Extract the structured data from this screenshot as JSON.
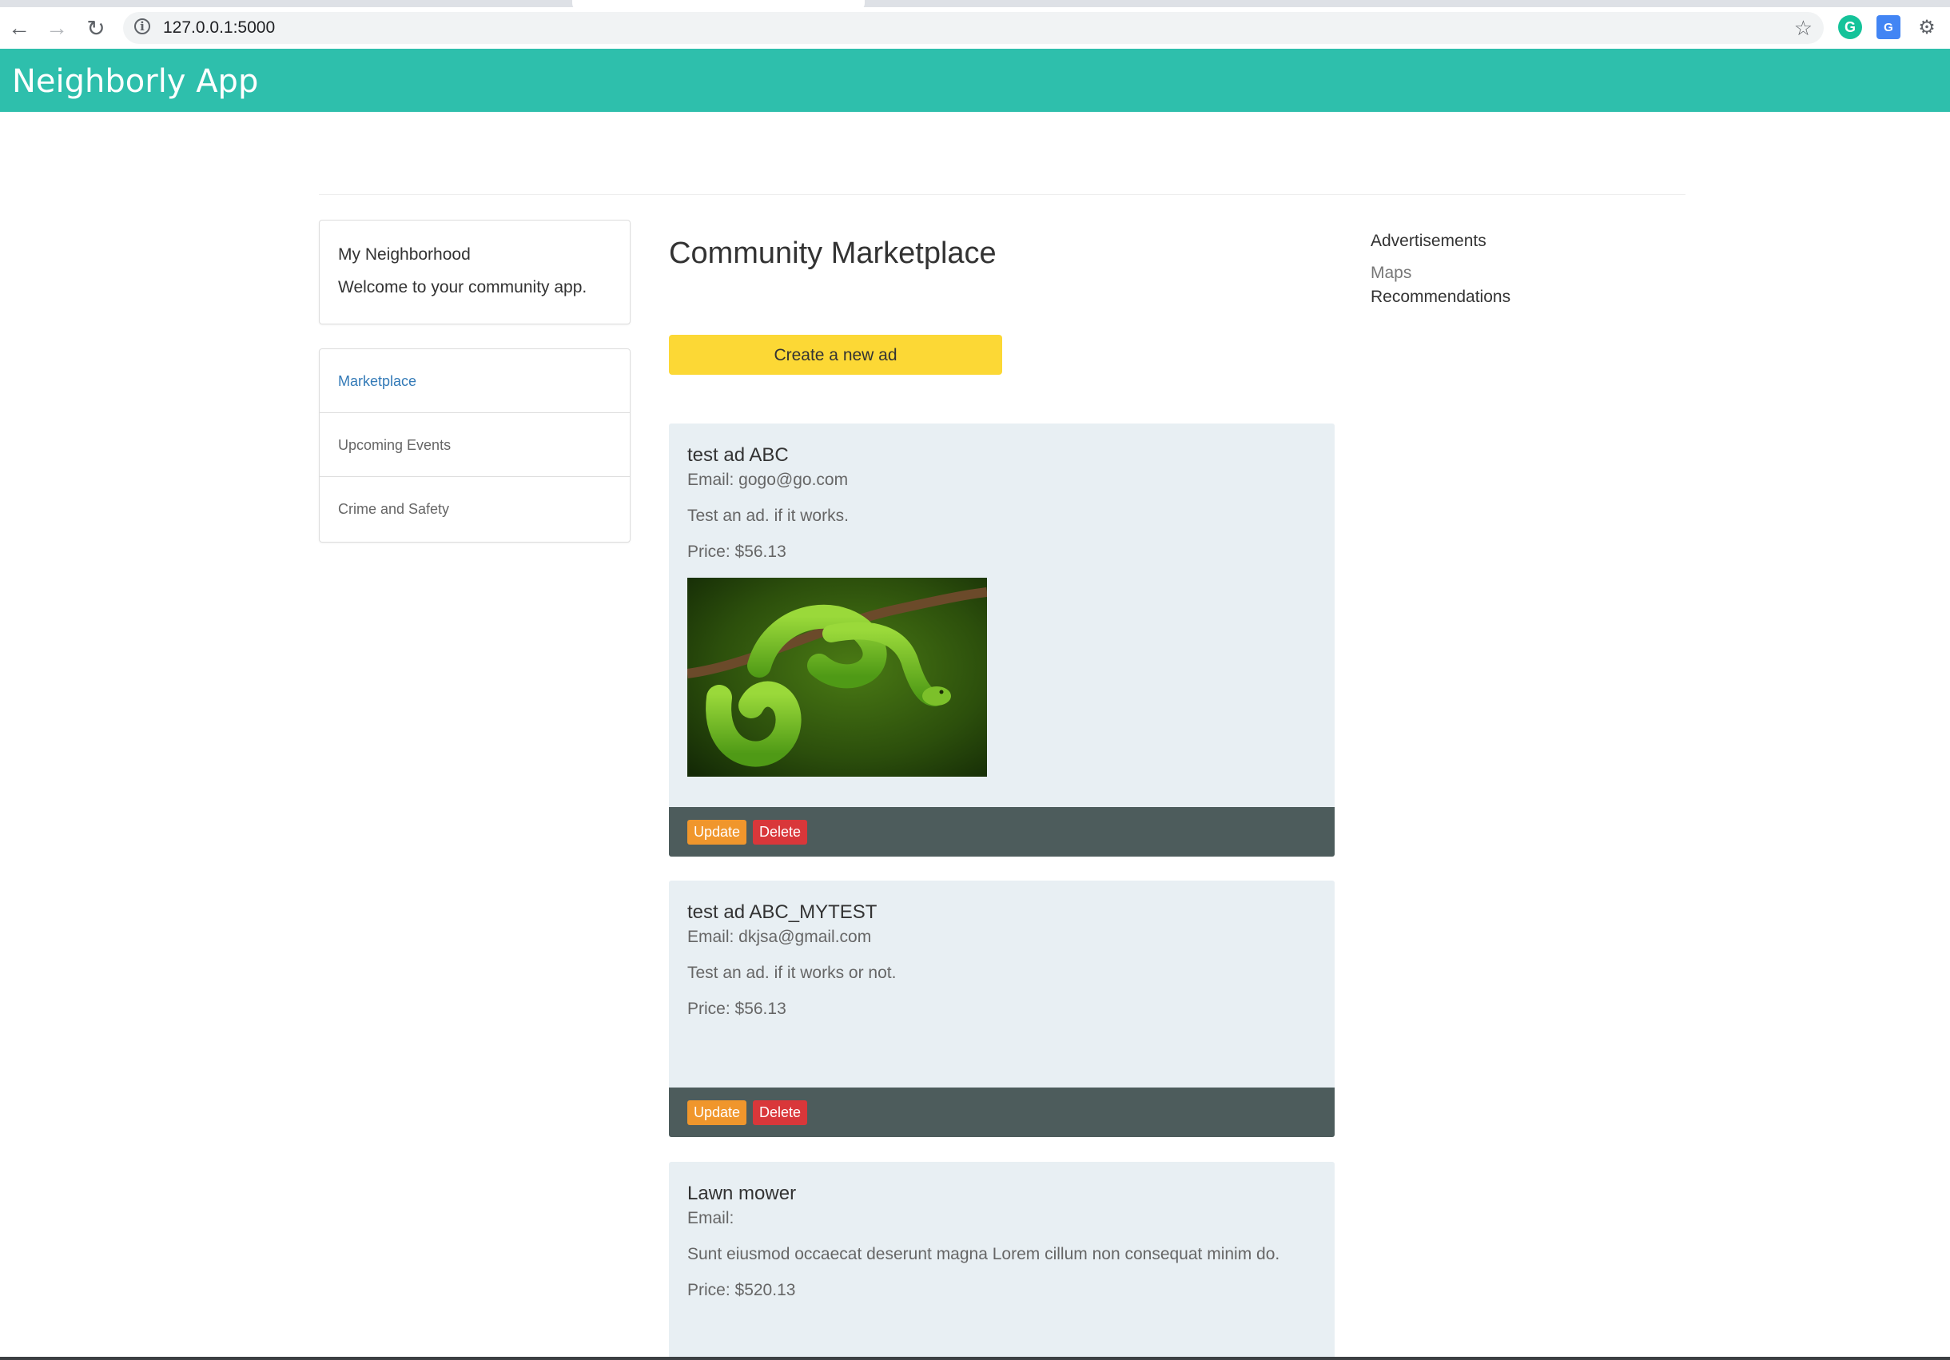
{
  "browser": {
    "url": "127.0.0.1:5000",
    "icons": {
      "back": "back-arrow-icon",
      "forward": "forward-arrow-icon",
      "reload": "reload-icon",
      "info": "info-icon",
      "bookmark": "star-icon",
      "extensions": [
        "grammarly-icon",
        "translate-icon",
        "puzzle-icon"
      ]
    }
  },
  "app": {
    "title": "Neighborly App",
    "brand_color": "#2ebfac"
  },
  "sidebar": {
    "intro": {
      "title": "My Neighborhood",
      "text": "Welcome to your community app."
    },
    "nav": [
      {
        "label": "Marketplace",
        "active": true
      },
      {
        "label": "Upcoming Events",
        "active": false
      },
      {
        "label": "Crime and Safety",
        "active": false
      }
    ]
  },
  "main": {
    "title": "Community Marketplace",
    "create_label": "Create a new ad",
    "ads": [
      {
        "title": "test ad ABC",
        "email": "Email: gogo@go.com",
        "description": "Test an ad. if it works.",
        "price": "Price: $56.13",
        "has_image": true,
        "update_label": "Update",
        "delete_label": "Delete"
      },
      {
        "title": "test ad ABC_MYTEST",
        "email": "Email: dkjsa@gmail.com",
        "description": "Test an ad. if it works or not.",
        "price": "Price: $56.13",
        "has_image": false,
        "update_label": "Update",
        "delete_label": "Delete"
      },
      {
        "title": "Lawn mower",
        "email": "Email:",
        "description": "Sunt eiusmod occaecat deserunt magna Lorem cillum non consequat minim do.",
        "price": "Price: $520.13",
        "has_image": false
      }
    ]
  },
  "right": {
    "title": "Advertisements",
    "links": [
      "Maps",
      "Recommendations"
    ]
  },
  "colors": {
    "create_button": "#fcd835",
    "update_button": "#f0962c",
    "delete_button": "#d9373a",
    "card_bg": "#e8eff3",
    "card_footer": "#4d5c5c"
  }
}
